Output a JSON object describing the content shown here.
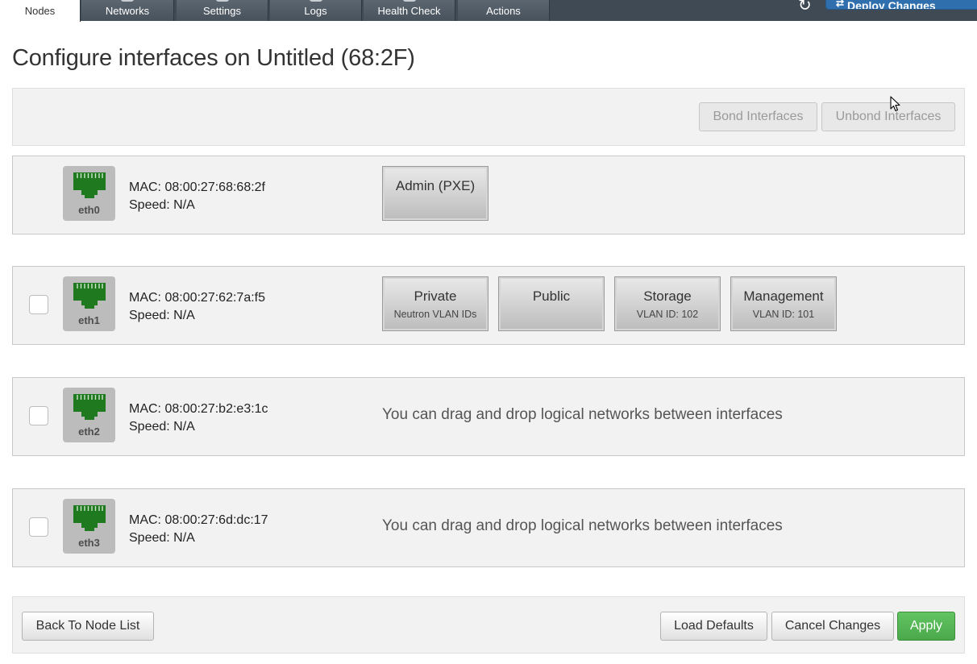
{
  "tabs": [
    {
      "label": "Nodes",
      "active": true
    },
    {
      "label": "Networks"
    },
    {
      "label": "Settings"
    },
    {
      "label": "Logs"
    },
    {
      "label": "Health Check"
    },
    {
      "label": "Actions"
    }
  ],
  "header": {
    "deploy_label": "Deploy Changes"
  },
  "page_title": "Configure interfaces on Untitled (68:2F)",
  "toolbar": {
    "bond_label": "Bond Interfaces",
    "unbond_label": "Unbond Interfaces"
  },
  "interfaces": [
    {
      "name": "eth0",
      "mac": "MAC: 08:00:27:68:68:2f",
      "speed": "Speed: N/A",
      "networks": [
        {
          "name": "Admin (PXE)",
          "sub": ""
        }
      ]
    },
    {
      "name": "eth1",
      "mac": "MAC: 08:00:27:62:7a:f5",
      "speed": "Speed: N/A",
      "networks": [
        {
          "name": "Private",
          "sub": "Neutron VLAN IDs"
        },
        {
          "name": "Public",
          "sub": ""
        },
        {
          "name": "Storage",
          "sub": "VLAN ID: 102"
        },
        {
          "name": "Management",
          "sub": "VLAN ID: 101"
        }
      ]
    },
    {
      "name": "eth2",
      "mac": "MAC: 08:00:27:b2:e3:1c",
      "speed": "Speed: N/A",
      "hint": "You can drag and drop logical networks between interfaces"
    },
    {
      "name": "eth3",
      "mac": "MAC: 08:00:27:6d:dc:17",
      "speed": "Speed: N/A",
      "hint": "You can drag and drop logical networks between interfaces"
    }
  ],
  "footer": {
    "back_label": "Back To Node List",
    "load_defaults_label": "Load Defaults",
    "cancel_label": "Cancel Changes",
    "apply_label": "Apply"
  },
  "colors": {
    "topbar": "#3f4a55",
    "port_icon": "#1f7a1f",
    "apply": "#4aa84a",
    "deploy": "#2f6fae"
  },
  "icons": {
    "port": "ethernet-port-icon",
    "deploy": "deploy-icon",
    "cursor": "mouse-pointer-icon"
  }
}
